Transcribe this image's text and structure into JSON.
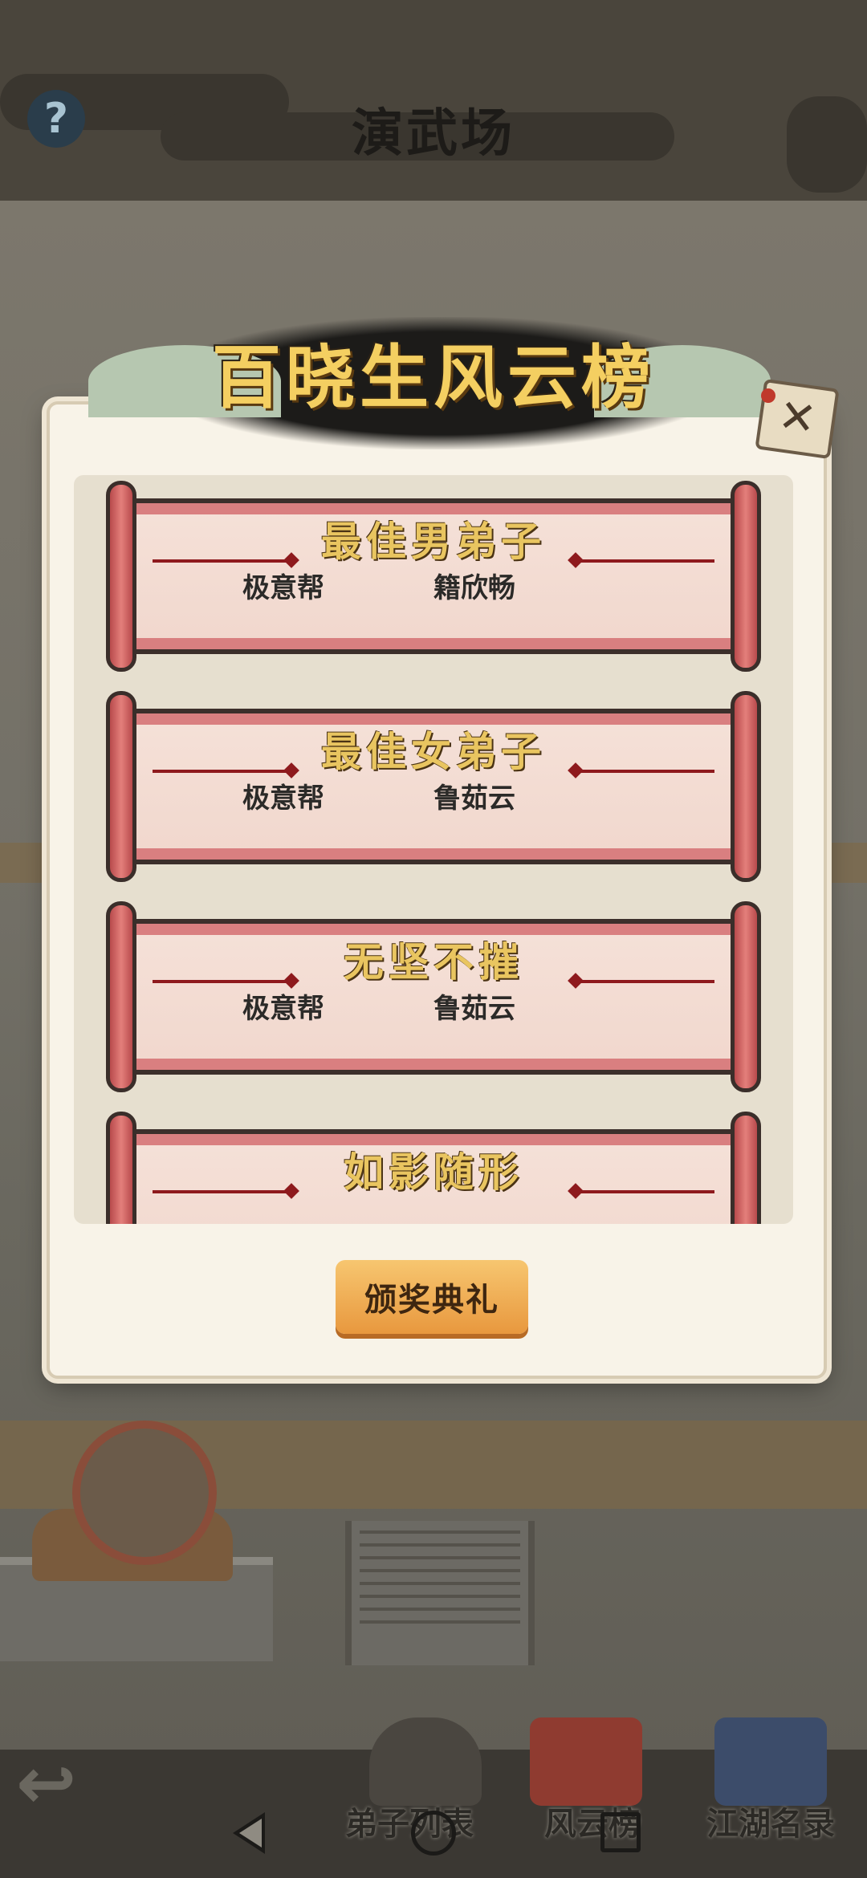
{
  "header": {
    "title": "演武场",
    "help_icon": "?"
  },
  "dialog": {
    "title": "百晓生风云榜",
    "close_icon": "✕",
    "awards": [
      {
        "title": "最佳男弟子",
        "guild": "极意帮",
        "winner": "籍欣畅"
      },
      {
        "title": "最佳女弟子",
        "guild": "极意帮",
        "winner": "鲁茹云"
      },
      {
        "title": "无坚不摧",
        "guild": "极意帮",
        "winner": "鲁茹云"
      },
      {
        "title": "如影随形",
        "guild": "",
        "winner": ""
      }
    ],
    "ceremony_button": "颁奖典礼"
  },
  "bottom_menu": {
    "items": [
      {
        "label": "弟子列表",
        "icon": "disciple-icon"
      },
      {
        "label": "风云榜",
        "icon": "ranking-scroll-icon"
      },
      {
        "label": "江湖名录",
        "icon": "book-icon"
      }
    ],
    "back_icon": "back-arrow-icon"
  },
  "android_nav": {
    "back": "nav-back-icon",
    "home": "nav-home-icon",
    "recent": "nav-recent-icon"
  },
  "colors": {
    "title_gold": "#f4cf61",
    "scroll_red": "#d97f80",
    "button_orange": "#f0a84e"
  }
}
